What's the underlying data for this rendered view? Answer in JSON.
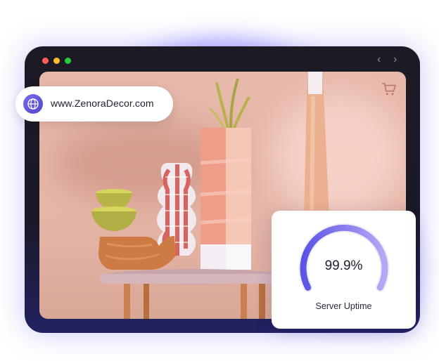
{
  "browser": {
    "window_controls": [
      "close",
      "minimize",
      "maximize"
    ],
    "nav": {
      "back_icon": "chevron-left-icon",
      "forward_icon": "chevron-right-icon"
    }
  },
  "address": {
    "url": "www.ZenoraDecor.com",
    "icon": "globe-icon"
  },
  "store": {
    "cart_icon": "cart-icon"
  },
  "uptime": {
    "value": "99.9%",
    "label": "Server Uptime",
    "fraction": 0.999
  },
  "colors": {
    "accent": "#6f68ff",
    "frame": "#1c1b25",
    "screen": "#e7b9ab"
  }
}
